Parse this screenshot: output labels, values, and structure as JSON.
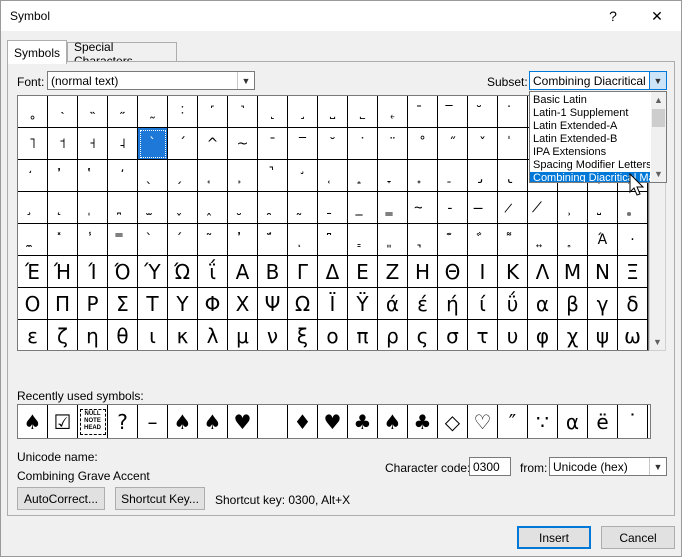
{
  "window": {
    "title": "Symbol"
  },
  "tabs": [
    {
      "label": "Symbols",
      "active": true
    },
    {
      "label": "Special Characters",
      "active": false
    }
  ],
  "font": {
    "label": "Font:",
    "value": "(normal text)"
  },
  "subset": {
    "label": "Subset:",
    "value": "Combining Diacritical M",
    "options": [
      "Basic Latin",
      "Latin-1 Supplement",
      "Latin Extended-A",
      "Latin Extended-B",
      "IPA Extensions",
      "Spacing Modifier Letters",
      "Combining Diacritical Marks"
    ],
    "selected_index": 6
  },
  "symbol_grid": {
    "rows": [
      [
        "˳",
        "˴",
        "˵",
        "˶",
        "˷",
        "˸",
        "˹",
        "˺",
        "˻",
        "˼",
        "˽",
        "˾",
        "˿",
        "̄",
        "̅",
        "̆",
        "̇",
        "̈",
        "̉",
        "̊",
        "̋"
      ],
      [
        "˥",
        "˦",
        "˧",
        "˨",
        "`",
        "´",
        "^",
        "~",
        "¯",
        "‾",
        "˘",
        "˙",
        "¨",
        "˚",
        "˝",
        "ˇ",
        "̍",
        "̎",
        "̏",
        "̐",
        "̑"
      ],
      [
        "̒",
        "̓",
        "̔",
        "̕",
        "̖",
        "̗",
        "̘",
        "̙",
        "̚",
        "̛",
        "̜",
        "̝",
        "̞",
        "̟",
        "̠",
        "̡",
        "̢",
        "̣",
        "̤",
        "̥",
        "̦"
      ],
      [
        "̧",
        "̨",
        "̩",
        "̪",
        "̫",
        "̬",
        "̭",
        "̮",
        "̯",
        "̰",
        "̱",
        "̲",
        "̳",
        "̴",
        "̵",
        "̶",
        "̷",
        "̸",
        "̹",
        "̺",
        "̻"
      ],
      [
        "̼",
        "̽",
        "̾",
        "̿",
        "̀",
        "́",
        "͂",
        "̓",
        "̈́",
        "ͅ",
        "͆",
        "͇",
        "͈",
        "͉",
        "͊",
        "͋",
        "͌",
        "͍",
        "͎",
        "Ά",
        "·"
      ],
      [
        "Έ",
        "Ή",
        "Ί",
        "Ό",
        "Ύ",
        "Ώ",
        "ΐ",
        "Α",
        "Β",
        "Γ",
        "Δ",
        "Ε",
        "Ζ",
        "Η",
        "Θ",
        "Ι",
        "Κ",
        "Λ",
        "Μ",
        "Ν",
        "Ξ"
      ],
      [
        "Ο",
        "Π",
        "Ρ",
        "Σ",
        "Τ",
        "Υ",
        "Φ",
        "Χ",
        "Ψ",
        "Ω",
        "Ϊ",
        "Ϋ",
        "ά",
        "έ",
        "ή",
        "ί",
        "ΰ",
        "α",
        "β",
        "γ",
        "δ"
      ],
      [
        "ε",
        "ζ",
        "η",
        "θ",
        "ι",
        "κ",
        "λ",
        "μ",
        "ν",
        "ξ",
        "ο",
        "π",
        "ρ",
        "ς",
        "σ",
        "τ",
        "υ",
        "φ",
        "χ",
        "ψ",
        "ω"
      ]
    ],
    "selected": {
      "row": 1,
      "col": 4
    }
  },
  "recent": {
    "label": "Recently used symbols:",
    "symbols": [
      "♠",
      "☑",
      "NULL NOTE HEAD",
      "?",
      "–",
      "♠",
      "♠",
      "♥",
      " ",
      "♦",
      "♥",
      "♣",
      "♠",
      "♣",
      "◇",
      "♡",
      "″",
      "∵",
      "α",
      "ë",
      "˙"
    ]
  },
  "unicode_name": {
    "label": "Unicode name:",
    "value": "Combining Grave Accent"
  },
  "character_code": {
    "label": "Character code:",
    "value": "0300"
  },
  "from": {
    "label": "from:",
    "value": "Unicode (hex)"
  },
  "buttons": {
    "autocorrect": "AutoCorrect...",
    "shortcut_key": "Shortcut Key...",
    "insert": "Insert",
    "cancel": "Cancel"
  },
  "shortcut_text": "Shortcut key: 0300, Alt+X",
  "colors": {
    "selection": "#1e78d7",
    "dropdown_selection": "#0078d7",
    "primary_border": "#0078d7"
  }
}
